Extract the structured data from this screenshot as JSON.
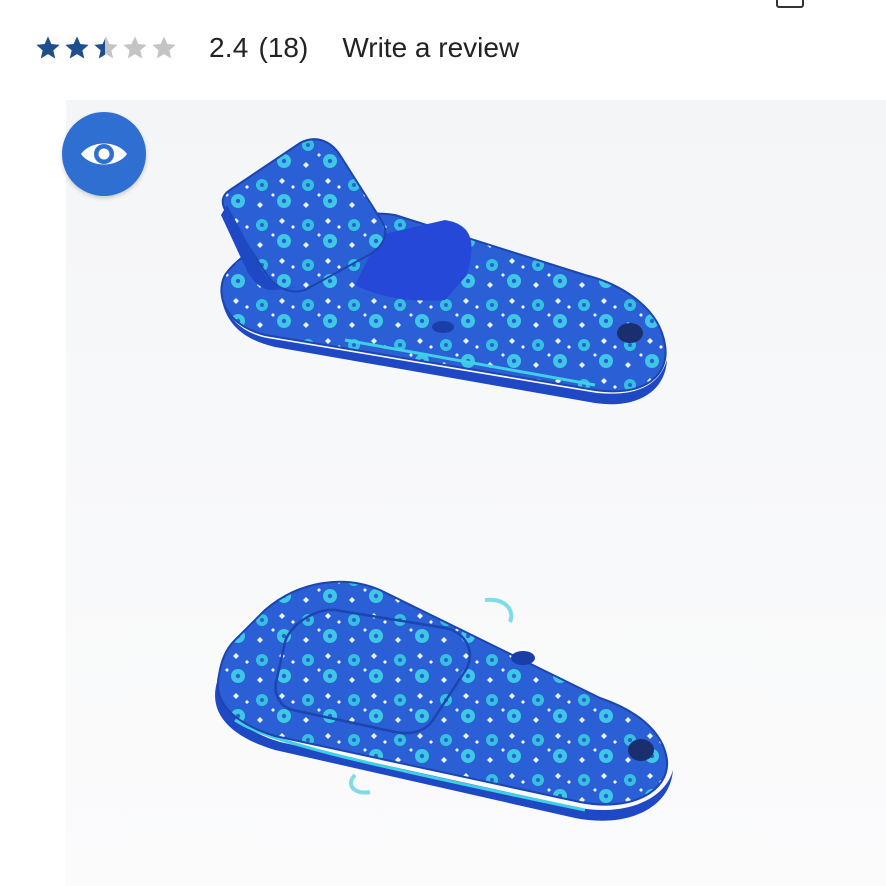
{
  "rating": {
    "value": "2.4",
    "count": "(18)",
    "stars_filled": 2.4,
    "stars_total": 5,
    "write_review_label": "Write a review",
    "star_color": "#1f4e8c",
    "star_empty_color": "#c4c4c4"
  },
  "view_button": {
    "icon": "eye-icon",
    "color": "#2f6fd1"
  },
  "product_images": {
    "items": [
      {
        "name": "float-reclined-view"
      },
      {
        "name": "float-flat-view"
      }
    ],
    "float_color": "#2a5fd6",
    "pattern_color": "#35c0e0"
  },
  "header": {
    "cart_icon": "shopping-bag-icon"
  }
}
